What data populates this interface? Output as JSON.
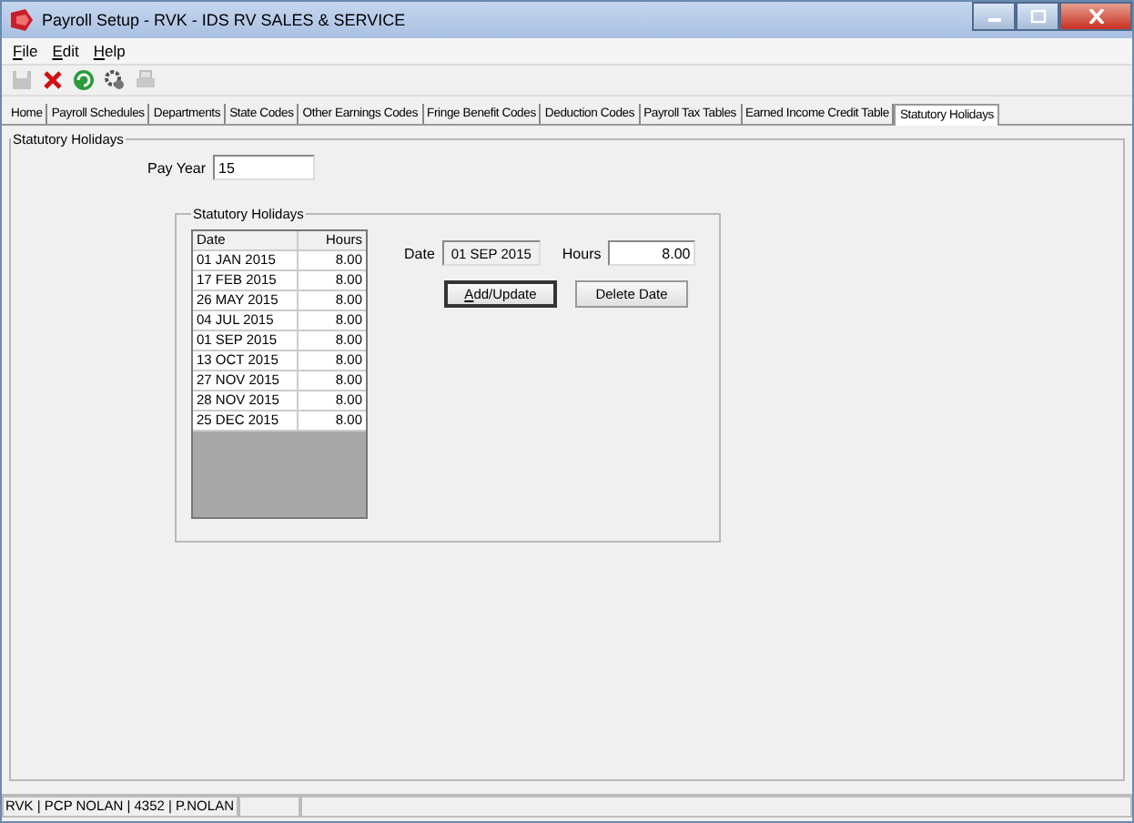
{
  "window": {
    "title": "Payroll Setup - RVK - IDS RV SALES & SERVICE"
  },
  "menu": [
    "File",
    "Edit",
    "Help"
  ],
  "toolbar": [
    {
      "kind": "save",
      "disabled": true
    },
    {
      "kind": "delete",
      "disabled": false
    },
    {
      "kind": "refresh",
      "disabled": false
    },
    {
      "kind": "gears",
      "disabled": false
    },
    {
      "kind": "print",
      "disabled": true
    }
  ],
  "tabs": [
    {
      "label": "Home",
      "selected": false
    },
    {
      "label": "Payroll Schedules",
      "selected": false
    },
    {
      "label": "Departments",
      "selected": false
    },
    {
      "label": "State Codes",
      "selected": false
    },
    {
      "label": "Other Earnings Codes",
      "selected": false
    },
    {
      "label": "Fringe Benefit Codes",
      "selected": false
    },
    {
      "label": "Deduction Codes",
      "selected": false
    },
    {
      "label": "Payroll Tax Tables",
      "selected": false
    },
    {
      "label": "Earned Income Credit Table",
      "selected": false
    },
    {
      "label": "Statutory Holidays",
      "selected": true
    }
  ],
  "group_title": "Statutory Holidays",
  "pay_year": {
    "label": "Pay Year",
    "value": "15"
  },
  "holidays": {
    "title": "Statutory Holidays",
    "columns": [
      "Date",
      "Hours"
    ],
    "rows": [
      [
        "01 JAN 2015",
        "8.00"
      ],
      [
        "17 FEB 2015",
        "8.00"
      ],
      [
        "26 MAY 2015",
        "8.00"
      ],
      [
        "04 JUL 2015",
        "8.00"
      ],
      [
        "01 SEP 2015",
        "8.00"
      ],
      [
        "13 OCT 2015",
        "8.00"
      ],
      [
        "27 NOV 2015",
        "8.00"
      ],
      [
        "28 NOV 2015",
        "8.00"
      ],
      [
        "25 DEC 2015",
        "8.00"
      ]
    ],
    "date": {
      "label": "Date",
      "value": "01 SEP 2015"
    },
    "hours": {
      "label": "Hours",
      "value": "8.00"
    },
    "buttons": [
      "Add/Update",
      "Delete Date"
    ]
  },
  "status_bar": [
    "RVK | PCP NOLAN | 4352 | P.NOLAN"
  ]
}
